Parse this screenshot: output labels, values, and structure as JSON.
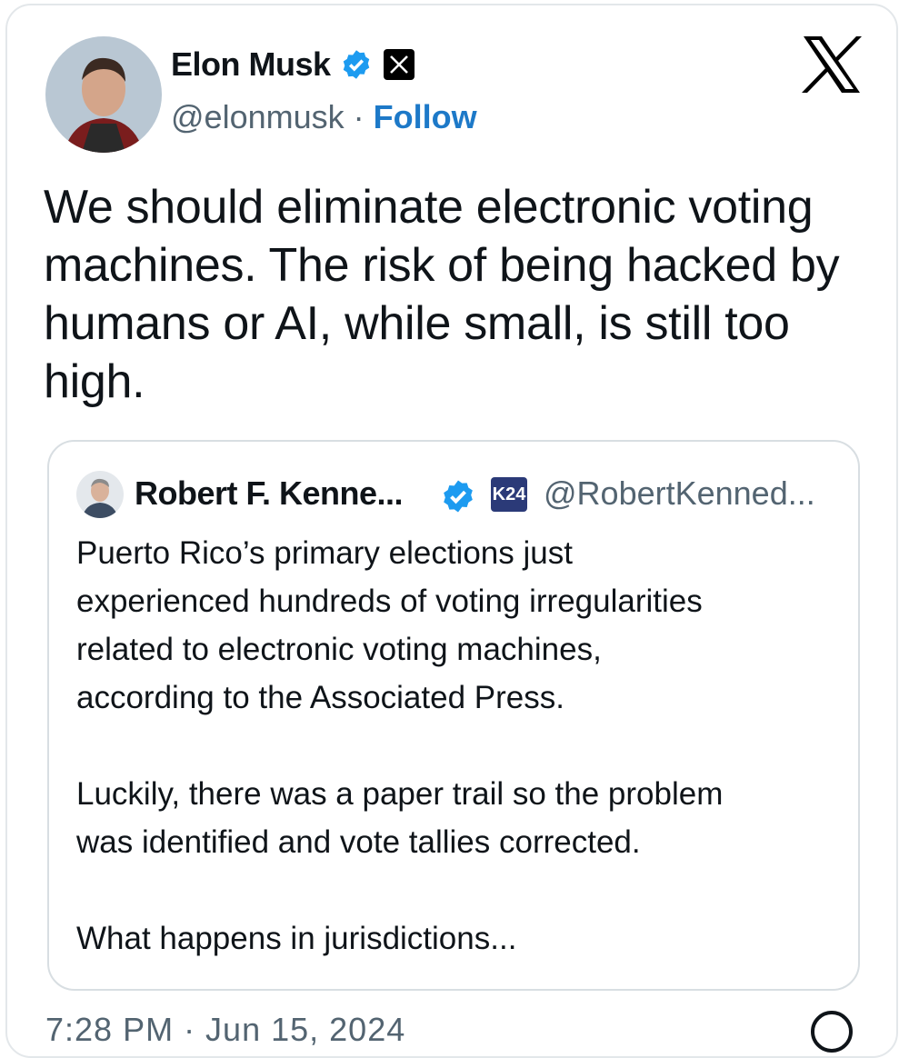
{
  "author": {
    "name": "Elon Musk",
    "handle": "@elonmusk",
    "separator": "·",
    "follow_label": "Follow"
  },
  "tweet_text": "We should eliminate electronic voting machines. The risk of being hacked by humans or AI, while small, is still too high.",
  "quoted": {
    "name": "Robert F. Kenne...",
    "badge_text": "K24",
    "handle": "@RobertKenned...",
    "text": "Puerto Rico’s primary elections just\nexperienced hundreds of voting irregularities\nrelated to electronic voting machines,\naccording to the Associated Press.\n\nLuckily, there was a paper trail so the problem\nwas identified and vote tallies corrected.\n\nWhat happens in jurisdictions..."
  },
  "timestamp": "7:28 PM · Jun 15, 2024",
  "colors": {
    "accent": "#1d79c8",
    "verified": "#1d9bf0",
    "secondary_text": "#536471",
    "border": "#d8dee2"
  },
  "icons": {
    "verified": "verified-check-icon",
    "x_logo": "x-logo-icon",
    "info": "info-icon"
  }
}
